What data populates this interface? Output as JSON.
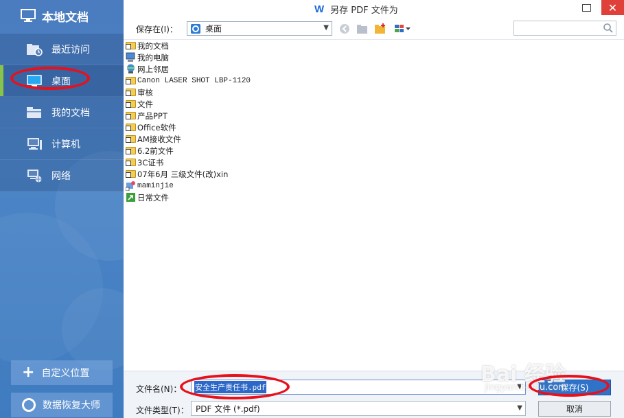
{
  "sidebar": {
    "header_title": "本地文档",
    "items": [
      {
        "label": "最近访问",
        "icon": "recent-folder-icon"
      },
      {
        "label": "桌面",
        "icon": "desktop-icon"
      },
      {
        "label": "我的文档",
        "icon": "folder-icon"
      },
      {
        "label": "计算机",
        "icon": "computer-icon"
      },
      {
        "label": "网络",
        "icon": "network-icon"
      }
    ],
    "active_index": 1,
    "custom_location_label": "自定义位置",
    "data_recovery_label": "数据恢复大师"
  },
  "titlebar": {
    "logo": "W",
    "title": "另存 PDF 文件为",
    "close_glyph": "✕"
  },
  "toolbar": {
    "save_in_label": "保存在(I)：",
    "save_in_value": "桌面",
    "search_placeholder": ""
  },
  "files": [
    {
      "name": "我的文档",
      "type": "folder-docs"
    },
    {
      "name": "我的电脑",
      "type": "computer"
    },
    {
      "name": "网上邻居",
      "type": "network"
    },
    {
      "name": "Canon LASER SHOT LBP-1120",
      "type": "shortcut-folder"
    },
    {
      "name": "审核",
      "type": "shortcut-folder"
    },
    {
      "name": "文件",
      "type": "shortcut-folder"
    },
    {
      "name": "产品PPT",
      "type": "shortcut-folder"
    },
    {
      "name": "Office软件",
      "type": "shortcut-folder"
    },
    {
      "name": "AM接收文件",
      "type": "shortcut-folder"
    },
    {
      "name": "6.2前文件",
      "type": "shortcut-folder"
    },
    {
      "name": "3C证书",
      "type": "shortcut-folder"
    },
    {
      "name": "07年6月 三级文件(改)xin",
      "type": "shortcut-folder"
    },
    {
      "name": "maminjie",
      "type": "user-shortcut"
    },
    {
      "name": "日常文件",
      "type": "green-shortcut"
    }
  ],
  "form": {
    "filename_label": "文件名(N)：",
    "filename_value": "安全生产责任书.pdf",
    "filetype_label": "文件类型(T)：",
    "filetype_value": "PDF 文件 (*.pdf)",
    "save_button": "保存(S)",
    "cancel_button": "取消"
  },
  "watermark": {
    "main": "Bai 经验",
    "sub": "jingyan.baidu.com"
  },
  "colors": {
    "sidebar": "#4a7cbf",
    "active_bar": "#88c34a",
    "annotation": "#e8101a",
    "save_button": "#2f73c9"
  }
}
